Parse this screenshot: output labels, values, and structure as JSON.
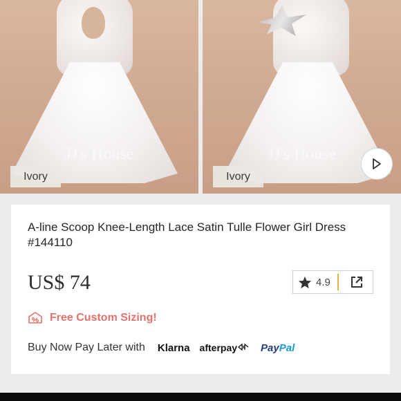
{
  "gallery": {
    "images": [
      {
        "color_label": "Ivory",
        "watermark": "JJ's House"
      },
      {
        "color_label": "Ivory",
        "watermark": "JJ's House"
      }
    ],
    "play_icon": "play-icon"
  },
  "product": {
    "title": "A-line Scoop Knee-Length Lace Satin Tulle Flower Girl Dress #144110",
    "price": "US$ 74",
    "rating": "4.9",
    "rating_icon": "star-icon",
    "share_icon": "share-icon",
    "custom_sizing": "Free Custom Sizing!",
    "custom_icon": "ruler-tag-icon",
    "pay_later_text": "Buy Now Pay Later with",
    "payment_providers": {
      "klarna": "Klarna",
      "afterpay": "afterpay",
      "paypal_pay": "Pay",
      "paypal_pal": "Pal"
    }
  },
  "colors": {
    "accent_pink": "#e1736c",
    "rating_divider": "#e1b73f",
    "paypal_dark": "#253b80",
    "paypal_light": "#179bd7"
  }
}
